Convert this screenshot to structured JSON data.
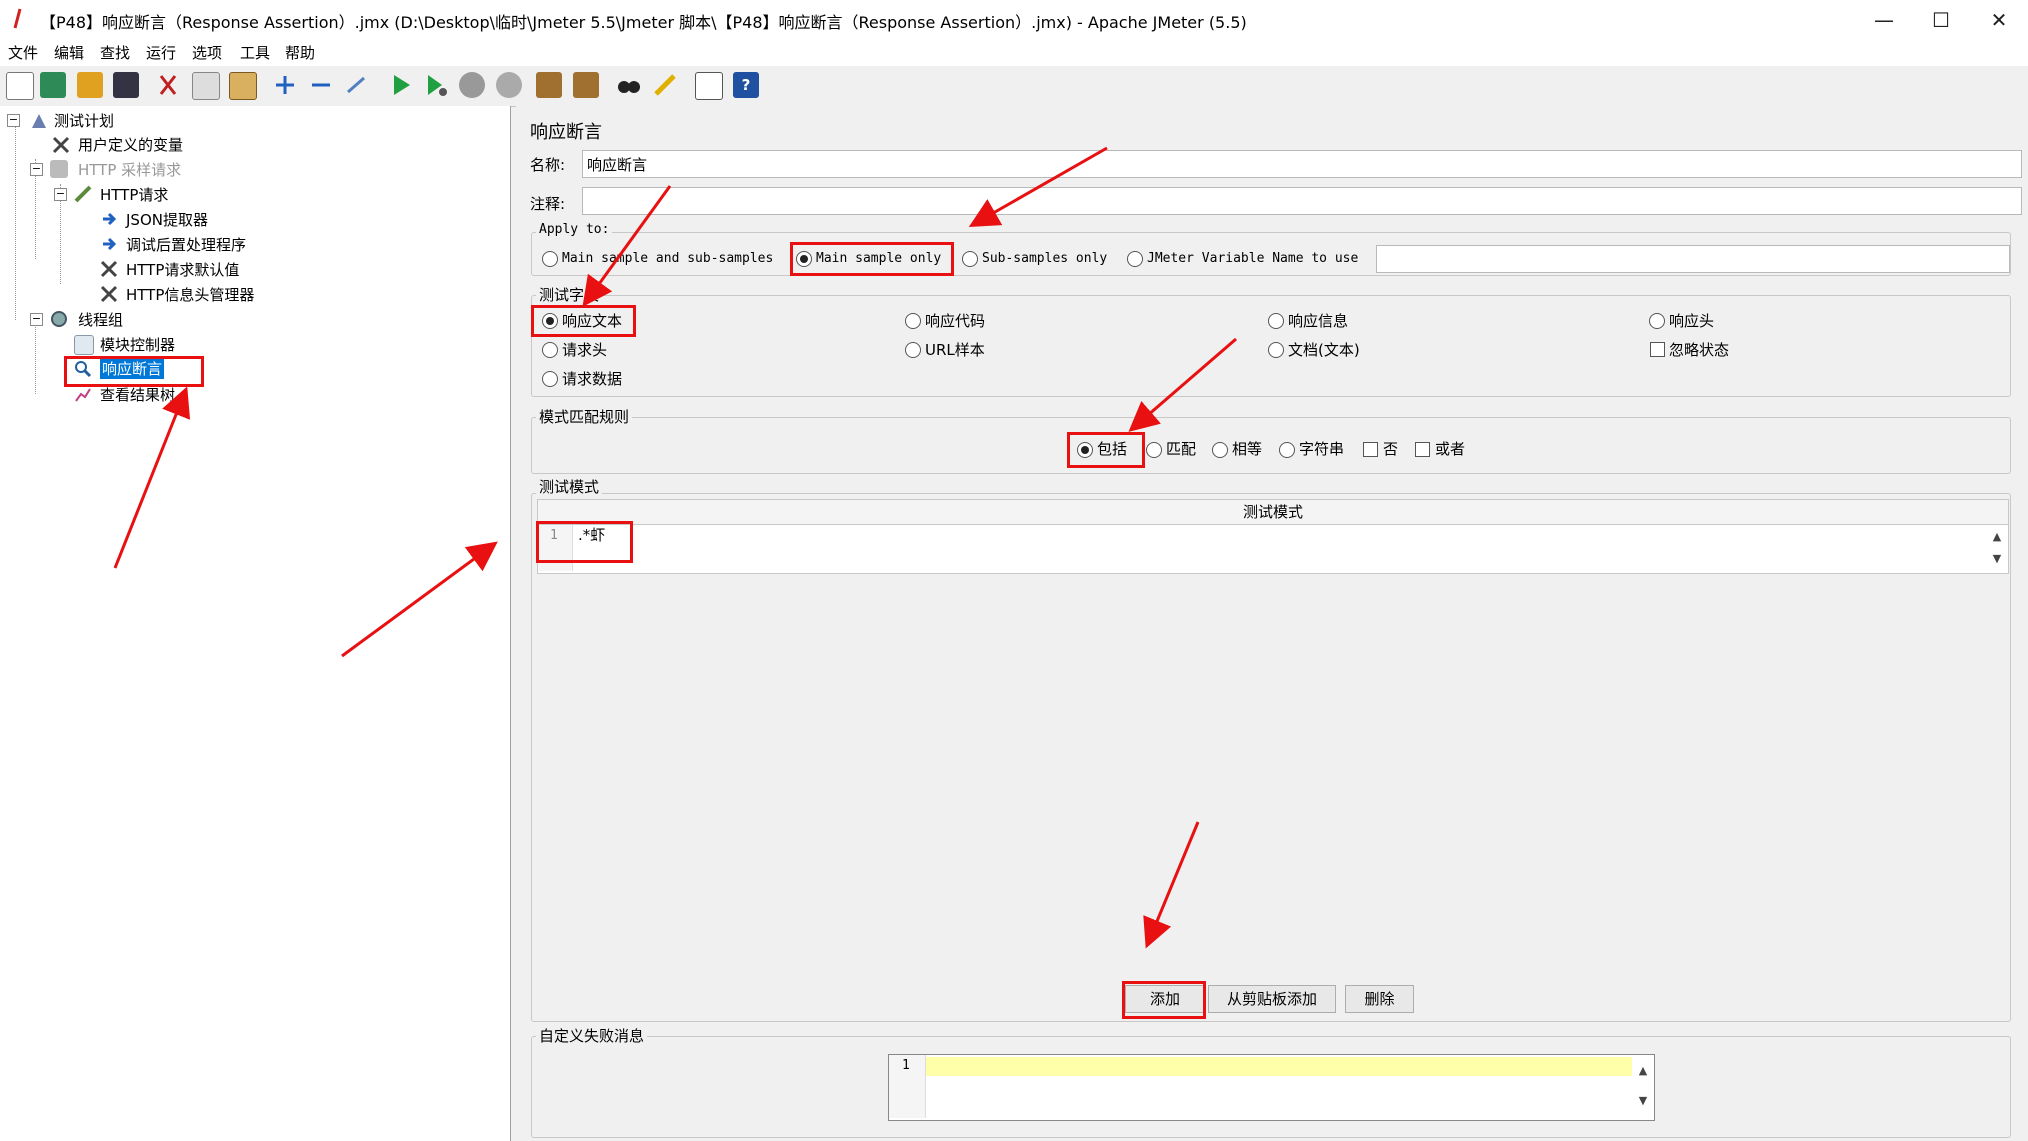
{
  "window": {
    "title": "【P48】响应断言（Response Assertion）.jmx (D:\\Desktop\\临时\\Jmeter 5.5\\Jmeter 脚本\\【P48】响应断言（Response Assertion）.jmx) - Apache JMeter (5.5)",
    "controls": [
      "—",
      "☐",
      "✕"
    ]
  },
  "menu": [
    "文件",
    "编辑",
    "查找",
    "运行",
    "选项",
    "工具",
    "帮助"
  ],
  "toolbar_icons": [
    "new-icon",
    "templates-icon",
    "open-icon",
    "save-icon",
    "cut-icon",
    "copy-icon",
    "paste-icon",
    "expand-icon",
    "collapse-icon",
    "toggle-icon",
    "start-icon",
    "start-no-pause-icon",
    "stop-icon",
    "shutdown-icon",
    "clear-icon",
    "clear-all-icon",
    "search-icon",
    "reset-search-icon",
    "function-helper-icon",
    "help-icon"
  ],
  "tree": {
    "items": [
      {
        "label": "测试计划"
      },
      {
        "label": "用户定义的变量"
      },
      {
        "label": "HTTP 采样请求"
      },
      {
        "label": "HTTP请求"
      },
      {
        "label": "JSON提取器"
      },
      {
        "label": "调试后置处理程序"
      },
      {
        "label": "HTTP请求默认值"
      },
      {
        "label": "HTTP信息头管理器"
      },
      {
        "label": "线程组"
      },
      {
        "label": "模块控制器"
      },
      {
        "label": "响应断言"
      },
      {
        "label": "查看结果树"
      }
    ]
  },
  "panel": {
    "title": "响应断言",
    "name_label": "名称:",
    "name_value": "响应断言",
    "comment_label": "注释:",
    "comment_value": "",
    "apply_to": {
      "title": "Apply to:",
      "options": [
        "Main sample and sub-samples",
        "Main sample only",
        "Sub-samples only",
        "JMeter Variable Name to use"
      ],
      "selected": "Main sample only",
      "variable_value": ""
    },
    "field_to_test": {
      "title": "测试字段",
      "options": [
        "响应文本",
        "响应代码",
        "响应信息",
        "响应头",
        "请求头",
        "URL样本",
        "文档(文本)",
        "请求数据"
      ],
      "checkbox": "忽略状态",
      "selected": "响应文本"
    },
    "pattern_rules": {
      "title": "模式匹配规则",
      "radios": [
        "包括",
        "匹配",
        "相等",
        "字符串"
      ],
      "checkboxes": [
        "否",
        "或者"
      ],
      "selected": "包括"
    },
    "patterns": {
      "title": "测试模式",
      "column_header": "测试模式",
      "line_number": "1",
      "value": ".*虾"
    },
    "buttons": [
      "添加",
      "从剪贴板添加",
      "删除"
    ],
    "custom_failure": {
      "title": "自定义失败消息",
      "line_number": "1",
      "value": ""
    }
  },
  "colors": {
    "highlight_red": "#e81010",
    "selection_blue": "#0078d7",
    "editor_line_yellow": "#ffffaa"
  }
}
